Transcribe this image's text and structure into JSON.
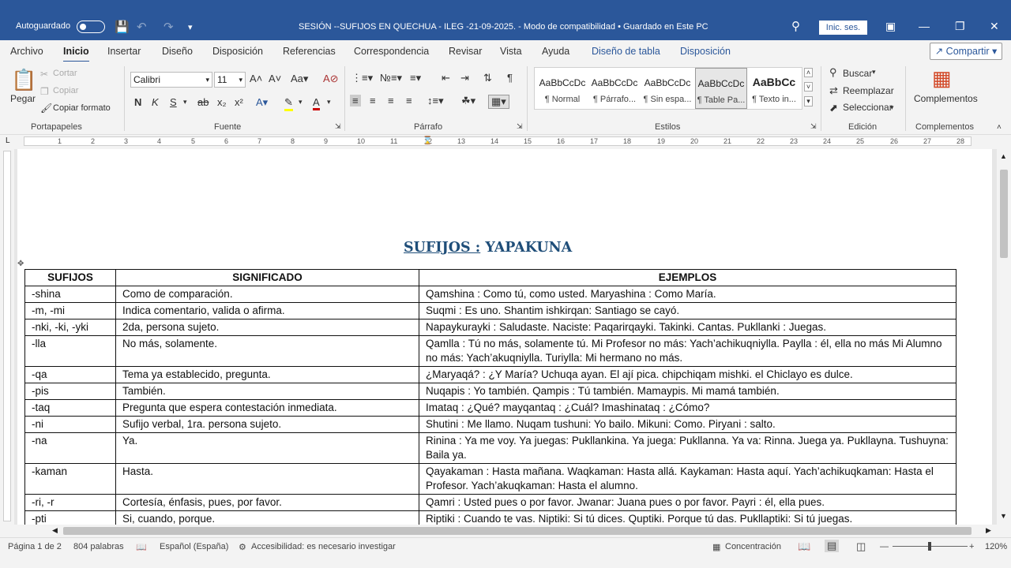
{
  "titlebar": {
    "autosave_label": "Autoguardado",
    "document_title": "SESIÓN --SUFIJOS EN QUECHUA - ILEG -21-09-2025.  -  Modo de compatibilidad  •  Guardado en Este PC",
    "signin_label": "Inic. ses."
  },
  "tabs": {
    "items": [
      "Archivo",
      "Inicio",
      "Insertar",
      "Diseño",
      "Disposición",
      "Referencias",
      "Correspondencia",
      "Revisar",
      "Vista",
      "Ayuda",
      "Diseño de tabla",
      "Disposición"
    ],
    "share_label": "Compartir"
  },
  "ribbon": {
    "clipboard": {
      "paste": "Pegar",
      "cut": "Cortar",
      "copy": "Copiar",
      "format_painter": "Copiar formato",
      "label": "Portapapeles"
    },
    "font": {
      "family": "Calibri",
      "size": "11",
      "label": "Fuente"
    },
    "paragraph": {
      "label": "Párrafo"
    },
    "styles": {
      "label": "Estilos",
      "items": [
        {
          "preview": "AaBbCcDc",
          "name": "¶ Normal"
        },
        {
          "preview": "AaBbCcDc",
          "name": "¶ Párrafo..."
        },
        {
          "preview": "AaBbCcDc",
          "name": "¶ Sin espa..."
        },
        {
          "preview": "AaBbCcDc",
          "name": "¶ Table Pa..."
        },
        {
          "preview": "AaBbCc",
          "name": "¶ Texto in..."
        }
      ]
    },
    "editing": {
      "find": "Buscar",
      "replace": "Reemplazar",
      "select": "Seleccionar",
      "label": "Edición"
    },
    "addins": {
      "button": "Complementos",
      "label": "Complementos"
    }
  },
  "ruler": {
    "numbers": [
      "1",
      "2",
      "3",
      "4",
      "5",
      "6",
      "7",
      "8",
      "9",
      "10",
      "11",
      "12",
      "13",
      "14",
      "15",
      "16",
      "17",
      "18",
      "19",
      "20",
      "21",
      "22",
      "23",
      "24",
      "25",
      "26",
      "27",
      "28"
    ]
  },
  "document": {
    "heading_left": "SUFIJOS :",
    "heading_right": " YAPAKUNA",
    "table": {
      "headers": [
        "SUFIJOS",
        "SIGNIFICADO",
        "EJEMPLOS"
      ],
      "rows": [
        [
          "-shina",
          "Como de comparación.",
          "Qamshina : Como tú, como usted.                 Maryashina : Como María."
        ],
        [
          "-m, -mi",
          "Indica comentario, valida o afirma.",
          "Suqmi : Es uno.                     Shantim ishkirqan: Santiago se cayó."
        ],
        [
          "-nki, -ki, -yki",
          "2da, persona sujeto.",
          "Napaykurayki : Saludaste.      Naciste: Paqarirqayki.   Takinki. Cantas.    Pukllanki : Juegas."
        ],
        [
          "-lla",
          "No más, solamente.",
          "Qamlla : Tú no más, solamente tú.   Mi Profesor no más: Yach’achikuqniylla.   Paylla : él, ella no más  Mi Alumno no más: Yach’akuqniylla.   Turiylla: Mi hermano no más."
        ],
        [
          "-qa",
          "Tema ya establecido, pregunta.",
          "¿Maryaqá? :  ¿Y María?             Uchuqa ayan.  El ají pica.    chipchiqam mishki. el Chiclayo es dulce."
        ],
        [
          "-pis",
          "También.",
          "Nuqapis : Yo también.       Qampis : Tú también.    Mamaypis. Mi mamá también."
        ],
        [
          "-taq",
          "Pregunta que espera contestación inmediata.",
          "Imataq : ¿Qué?   mayqantaq : ¿Cuál?      Imashinataq : ¿Cómo?"
        ],
        [
          "-ni",
          "Sufijo verbal, 1ra. persona sujeto.",
          "Shutini : Me llamo.             Nuqam tushuni: Yo bailo.           Mikuni: Como.       Piryani : salto."
        ],
        [
          "-na",
          "Ya.",
          "Rinina : Ya me voy.     Ya juegas: Pukllankina.     Ya juega: Pukllanna.      Ya va: Rinna.  Juega ya. Pukllayna.   Tushuyna: Baila ya."
        ],
        [
          "-kaman",
          "Hasta.",
          "Qayakaman : Hasta mañana.            Waqkaman: Hasta allá.              Kaykaman: Hasta aquí.  Yach’achikuqkaman: Hasta el Profesor.     Yach’akuqkaman: Hasta el alumno."
        ],
        [
          "-ri, -r",
          "Cortesía, énfasis, pues, por favor.",
          "Qamri : Usted pues o por favor.        Jwanar: Juana pues o por favor.       Payri : él, ella pues."
        ],
        [
          "-pti",
          "Si, cuando, porque.",
          "Riptiki : Cuando te vas.       Niptiki: Si tú dices.      Quptiki. Porque tú das.  Pukllaptiki: Si tú juegas."
        ]
      ]
    }
  },
  "status": {
    "page": "Página 1 de 2",
    "words": "804 palabras",
    "language": "Español (España)",
    "accessibility": "Accesibilidad: es necesario investigar",
    "focus": "Concentración",
    "zoom": "120%"
  }
}
